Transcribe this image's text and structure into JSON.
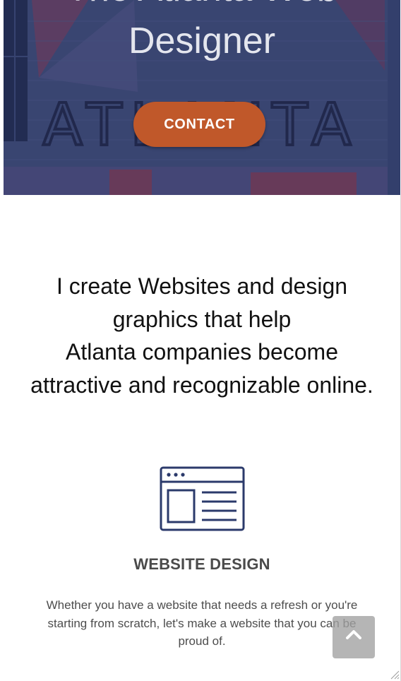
{
  "hero": {
    "title_partial": "The Atlanta Web",
    "title_line": "Designer",
    "sign_text": "ATLANTA",
    "contact_label": "CONTACT",
    "overlay_color": "#2f3c6e"
  },
  "intro": {
    "lines": [
      "I create Websites and design",
      "graphics that help",
      "Atlanta companies become",
      "attractive and recognizable online."
    ]
  },
  "service": {
    "icon": "browser-window-icon",
    "title": "WEBSITE DESIGN",
    "description": "Whether you have a website that needs a refresh or you're starting from scratch, let's make a website that you can be proud of."
  },
  "back_to_top": {
    "icon": "chevron-up-icon"
  },
  "colors": {
    "accent": "#c0582a",
    "icon_navy": "#2b3a6b",
    "heading_gray": "#4a4a4a"
  }
}
